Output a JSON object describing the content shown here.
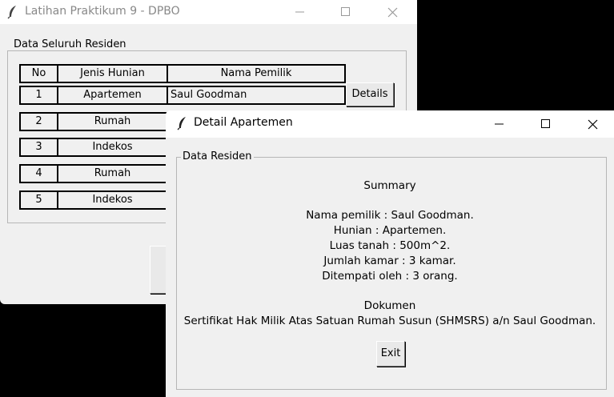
{
  "main_window": {
    "title": "Latihan Praktikum 9 - DPBO",
    "group_label": "Data Seluruh Residen",
    "columns": [
      "No",
      "Jenis Hunian",
      "Nama Pemilik"
    ],
    "rows": [
      {
        "no": "1",
        "jenis": "Apartemen",
        "nama": "Saul Goodman",
        "action": "Details"
      },
      {
        "no": "2",
        "jenis": "Rumah",
        "nama": ""
      },
      {
        "no": "3",
        "jenis": "Indekos",
        "nama": ""
      },
      {
        "no": "4",
        "jenis": "Rumah",
        "nama": ""
      },
      {
        "no": "5",
        "jenis": "Indekos",
        "nama": ""
      }
    ]
  },
  "detail_window": {
    "title": "Detail Apartemen",
    "group_label": "Data Residen",
    "summary_heading": "Summary",
    "lines": [
      "Nama pemilik : Saul Goodman.",
      "Hunian : Apartemen.",
      "Luas tanah : 500m^2.",
      "Jumlah kamar : 3 kamar.",
      "Ditempati oleh : 3 orang."
    ],
    "doc_heading": "Dokumen",
    "doc_text": "Sertifikat Hak Milik Atas Satuan Rumah Susun (SHMSRS) a/n Saul Goodman.",
    "exit_label": "Exit"
  }
}
